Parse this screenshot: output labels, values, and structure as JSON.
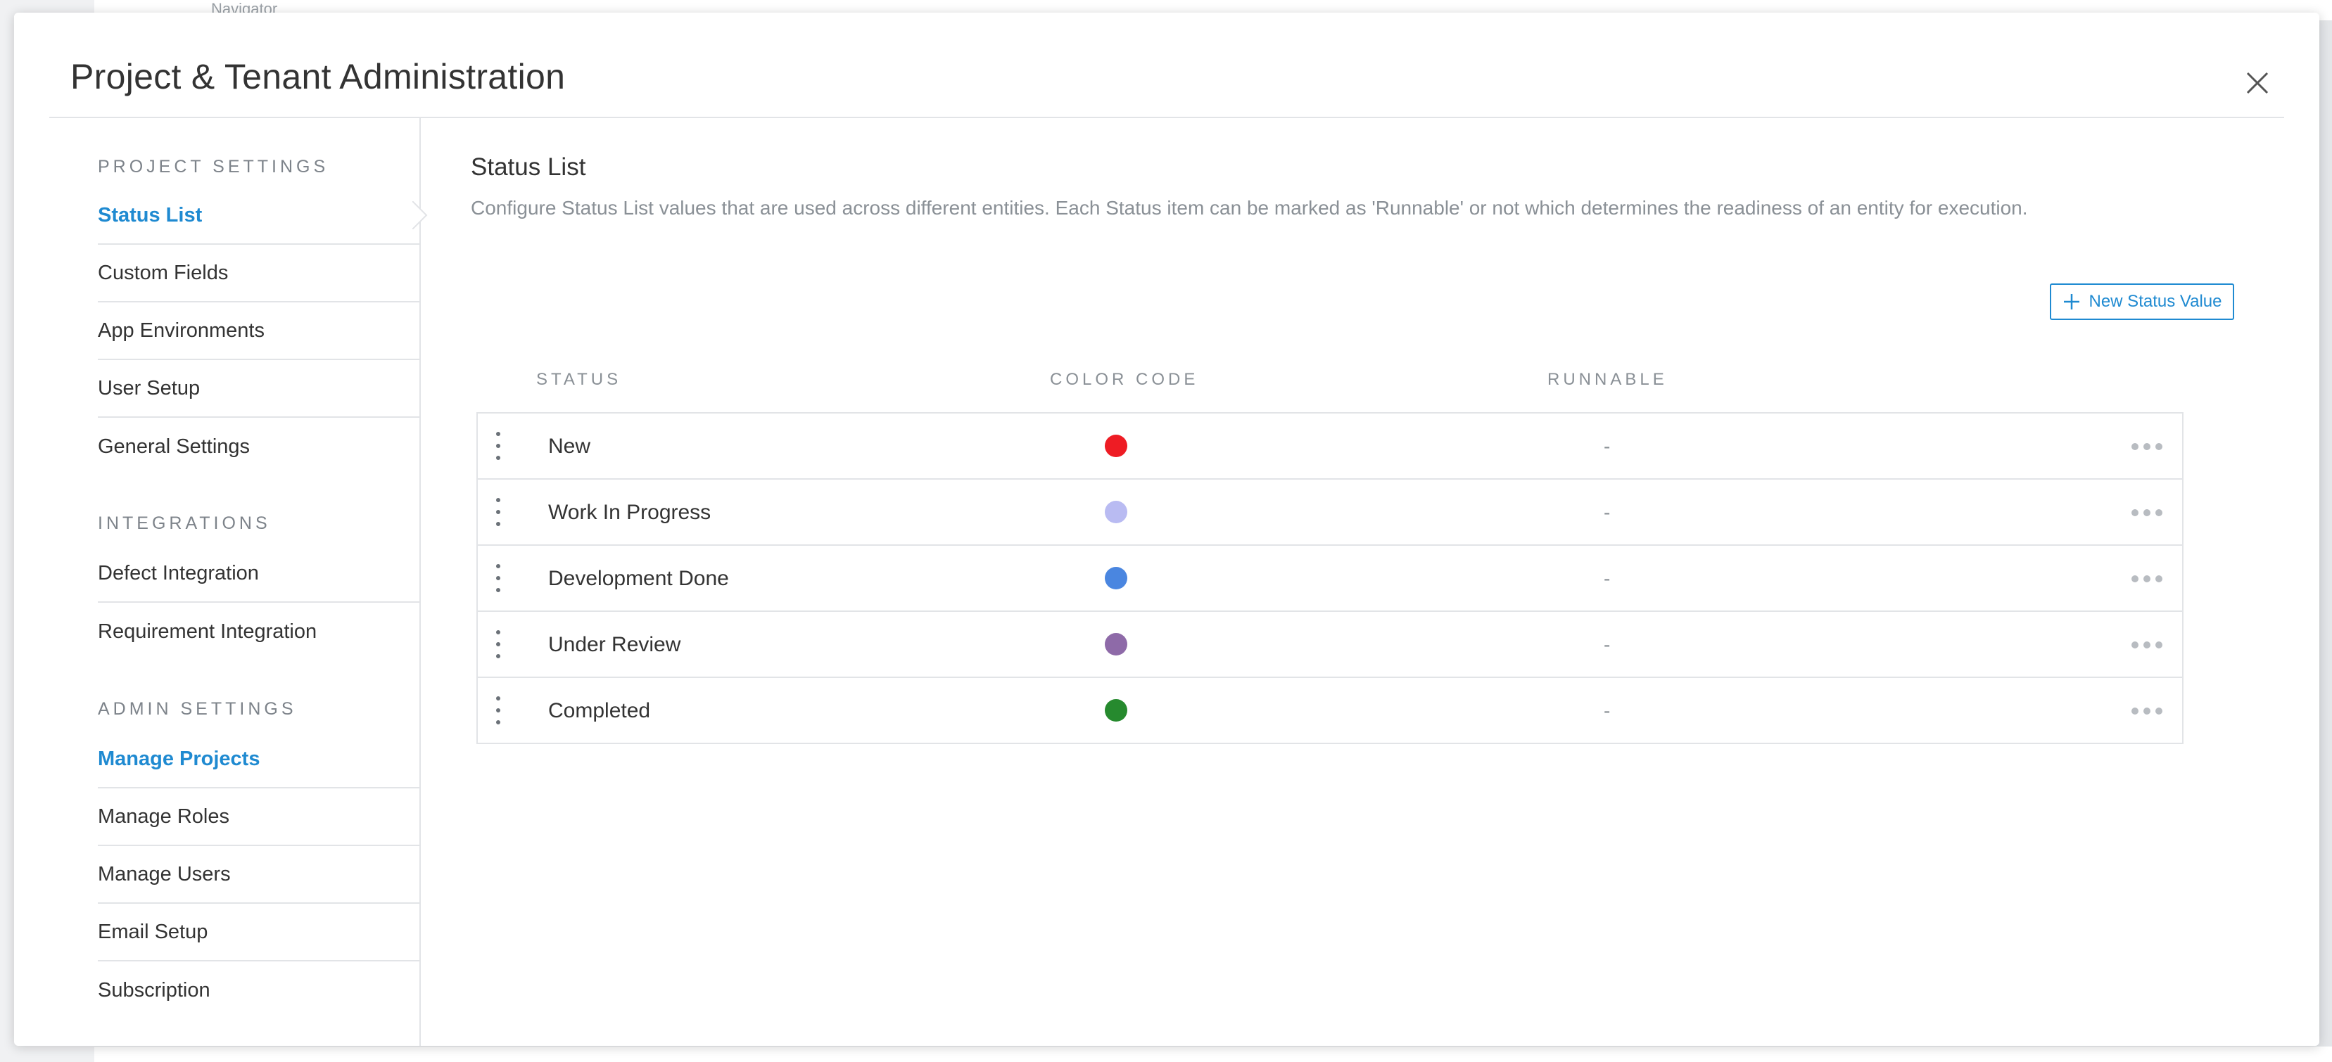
{
  "background": {
    "navigator_label": "Navigator"
  },
  "modal": {
    "title": "Project & Tenant Administration",
    "close_icon": "close-icon"
  },
  "sidebar": {
    "sections": [
      {
        "title": "PROJECT SETTINGS",
        "items": [
          {
            "label": "Status List",
            "active": true
          },
          {
            "label": "Custom Fields"
          },
          {
            "label": "App Environments"
          },
          {
            "label": "User Setup"
          },
          {
            "label": "General Settings"
          }
        ]
      },
      {
        "title": "INTEGRATIONS",
        "items": [
          {
            "label": "Defect Integration"
          },
          {
            "label": "Requirement Integration"
          }
        ]
      },
      {
        "title": "ADMIN SETTINGS",
        "items": [
          {
            "label": "Manage Projects",
            "highlight": true
          },
          {
            "label": "Manage Roles"
          },
          {
            "label": "Manage Users"
          },
          {
            "label": "Email Setup"
          },
          {
            "label": "Subscription"
          }
        ]
      }
    ]
  },
  "main": {
    "title": "Status List",
    "description": "Configure Status List values that are used across different entities. Each Status item can be marked as 'Runnable' or not which determines the readiness of an entity for execution.",
    "new_button_label": "New Status Value",
    "columns": {
      "status": "STATUS",
      "color_code": "COLOR CODE",
      "runnable": "RUNNABLE"
    },
    "rows": [
      {
        "name": "New",
        "color": "#ee1c24",
        "runnable": "-"
      },
      {
        "name": "Work In Progress",
        "color": "#b9bbf2",
        "runnable": "-"
      },
      {
        "name": "Development Done",
        "color": "#4a86e0",
        "runnable": "-"
      },
      {
        "name": "Under Review",
        "color": "#8e6aa8",
        "runnable": "-"
      },
      {
        "name": "Completed",
        "color": "#268a2e",
        "runnable": "-"
      }
    ]
  },
  "colors": {
    "accent": "#1f8ad1",
    "text": "#333333",
    "muted": "#8a9096",
    "border": "#e2e4e7"
  }
}
